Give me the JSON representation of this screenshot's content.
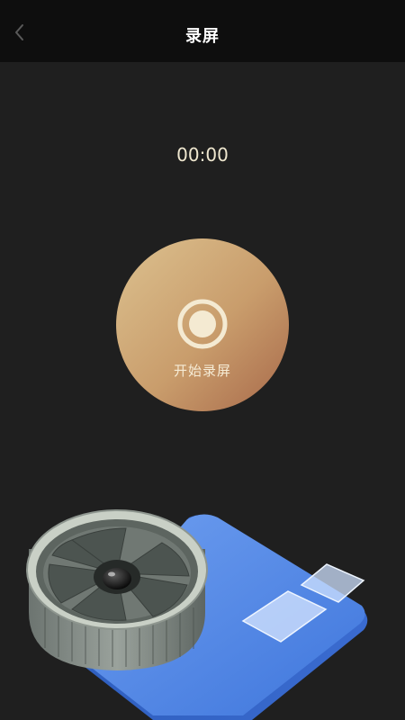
{
  "header": {
    "title": "录屏",
    "back_icon": "chevron-left-icon"
  },
  "timer": {
    "elapsed": "00:00"
  },
  "record_button": {
    "label": "开始录屏",
    "icon": "record-icon"
  },
  "colors": {
    "background": "#1f1f1f",
    "header_background": "#0e0e0e",
    "button_gradient_start": "#dcc18f",
    "button_gradient_end": "#a8694a",
    "timer_text": "#efe7cf"
  }
}
